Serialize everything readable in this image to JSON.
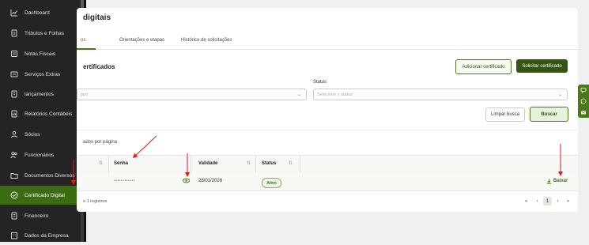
{
  "sidebar": {
    "items": [
      {
        "label": "Dashboard",
        "icon": "chart-icon"
      },
      {
        "label": "Tributos e Folhas",
        "icon": "document-icon"
      },
      {
        "label": "Notas Fiscais",
        "icon": "receipt-icon"
      },
      {
        "label": "Serviços Extras",
        "icon": "extras-icon"
      },
      {
        "label": "lançamentos",
        "icon": "ledger-icon"
      },
      {
        "label": "Relatórios Contábeis",
        "icon": "report-icon"
      },
      {
        "label": "Sócios",
        "icon": "people-icon"
      },
      {
        "label": "Funcionários",
        "icon": "employee-icon"
      },
      {
        "label": "Documentos Diversos",
        "icon": "folder-icon"
      },
      {
        "label": "Certificado Digital",
        "icon": "certificate-icon",
        "active": true
      },
      {
        "label": "Financeiro",
        "icon": "finance-icon"
      },
      {
        "label": "Dados da Empresa",
        "icon": "building-icon"
      }
    ]
  },
  "page": {
    "title": "digitais",
    "tabs": [
      {
        "label": "os",
        "active": true
      },
      {
        "label": "Orientações e etapas"
      },
      {
        "label": "Histórico de solicitações"
      }
    ]
  },
  "panel": {
    "title": "ertificados",
    "add_button": "Adicionar certificado",
    "request_button": "Solicitar certificado",
    "status_label": "Status",
    "type_placeholder": "ppo",
    "status_placeholder": "Selecione o status",
    "clear_button": "Limpar busca",
    "search_button": "Buscar"
  },
  "table": {
    "per_page_text": "ados por página",
    "columns": [
      "Senha",
      "Validade",
      "Status"
    ],
    "rows": [
      {
        "password": "••••••••••••",
        "validity": "28/01/2026",
        "status": "Ativo",
        "action": "Baixar"
      }
    ],
    "footer_text": "o 1 registros",
    "pagination": [
      "«",
      "‹",
      "1",
      "›",
      "»"
    ]
  },
  "colors": {
    "sidebar_bg": "#242424",
    "active_green": "#3c6b12",
    "brand_dark_green": "#33560f",
    "annotation_red": "#e31b1b"
  }
}
